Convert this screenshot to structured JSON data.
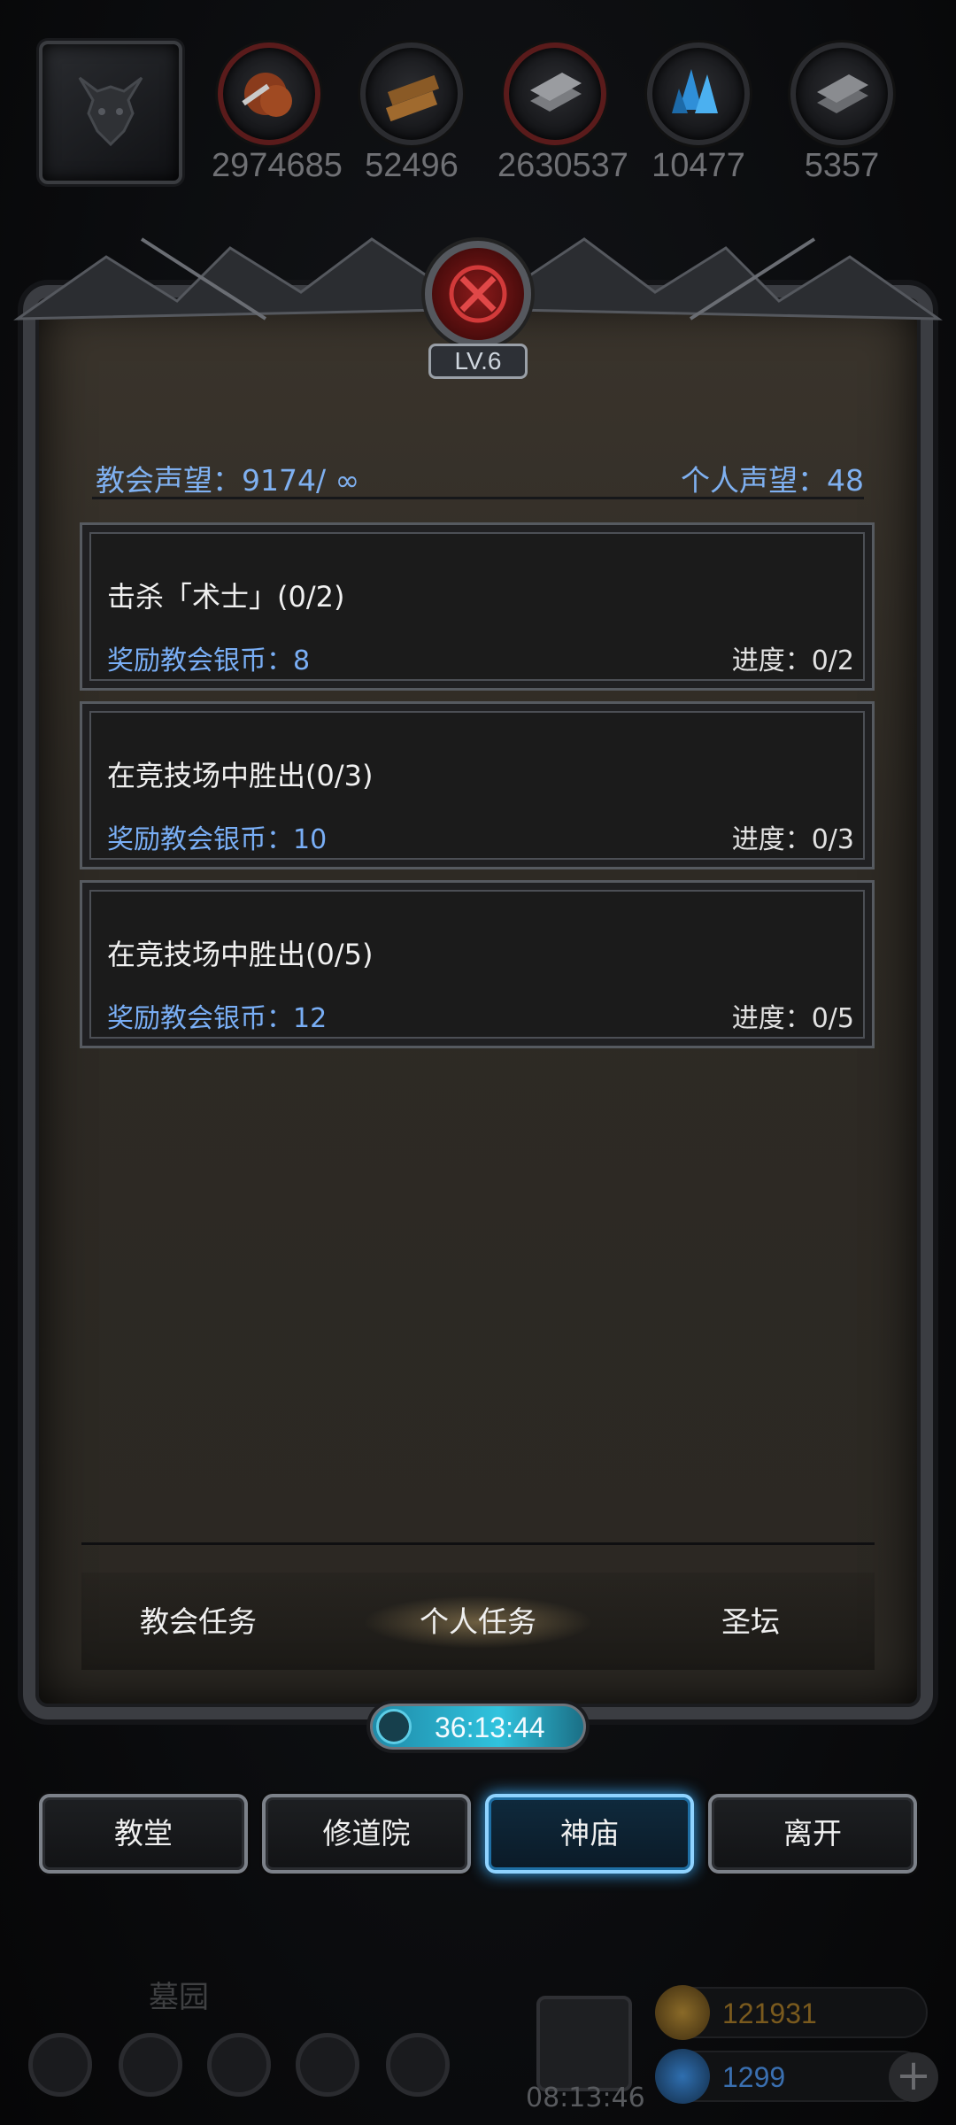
{
  "resources": [
    {
      "icon": "meat-icon",
      "value": "2974685"
    },
    {
      "icon": "wood-icon",
      "value": "52496"
    },
    {
      "icon": "iron-icon",
      "value": "2630537"
    },
    {
      "icon": "crystal-icon",
      "value": "10477"
    },
    {
      "icon": "steel-icon",
      "value": "5357"
    }
  ],
  "panel": {
    "level": "LV.6",
    "church_reputation": "教会声望：9174/ ∞",
    "personal_reputation": "个人声望：48"
  },
  "quests": [
    {
      "title": "击杀「术士」(0/2)",
      "reward": "奖励教会银币：8",
      "progress": "进度：0/2"
    },
    {
      "title": "在竞技场中胜出(0/3)",
      "reward": "奖励教会银币：10",
      "progress": "进度：0/3"
    },
    {
      "title": "在竞技场中胜出(0/5)",
      "reward": "奖励教会银币：12",
      "progress": "进度：0/5"
    }
  ],
  "tabs": [
    {
      "label": "教会任务",
      "active": false
    },
    {
      "label": "个人任务",
      "active": true
    },
    {
      "label": "圣坛",
      "active": false
    }
  ],
  "timer": "36:13:44",
  "nav": [
    {
      "label": "教堂",
      "active": false
    },
    {
      "label": "修道院",
      "active": false
    },
    {
      "label": "神庙",
      "active": true
    },
    {
      "label": "离开",
      "active": false
    }
  ],
  "bottom": {
    "location": "墓园",
    "clock": "08:13:46",
    "gold": "121931",
    "gems": "1299"
  },
  "colors": {
    "reputation_blue": "#7fb0f0",
    "reward_blue": "#79aef5",
    "active_glow": "#3aa6f0",
    "gold_text": "#7a5a1e",
    "gem_text": "#3a6fb0"
  }
}
